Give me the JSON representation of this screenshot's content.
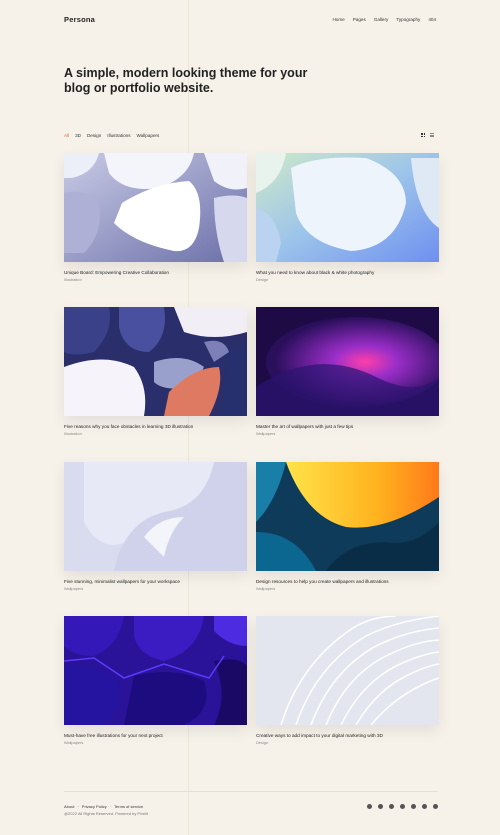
{
  "header": {
    "logo": "Persona",
    "nav": [
      "Home",
      "Pages",
      "Gallery",
      "Typography",
      "404"
    ]
  },
  "hero": {
    "title": "A simple, modern looking theme for your blog or portfolio website."
  },
  "filters": {
    "items": [
      "All",
      "3D",
      "Design",
      "Illustrations",
      "Wallpapers"
    ],
    "active": "All"
  },
  "posts": [
    {
      "title": "Unique Board: Empowering Creative Collaboration",
      "category": "Illustration"
    },
    {
      "title": "What you need to know about black & white photography",
      "category": "Design"
    },
    {
      "title": "Five reasons why you face obstacles in learning 3D illustration",
      "category": "Illustration"
    },
    {
      "title": "Master the art of wallpapers with just a few tips",
      "category": "Wallpapers"
    },
    {
      "title": "Five stunning, minimalist wallpapers for your workspace",
      "category": "Wallpapers"
    },
    {
      "title": "Design resources to help you create wallpapers and illustrations",
      "category": "Wallpapers"
    },
    {
      "title": "Must-have free illustrations for your next project",
      "category": "Wallpapers"
    },
    {
      "title": "Creative ways to add impact to your digital marketing with 3D",
      "category": "Design"
    }
  ],
  "footer": {
    "links": [
      "About",
      "Privacy Policy",
      "Terms of service"
    ],
    "copyright": "@2022 All Rights Reserved. Powered by Pixelit",
    "social_icons": [
      "github-icon",
      "twitter-icon",
      "instagram-icon",
      "linkedin-icon",
      "vimeo-icon",
      "pinterest-icon",
      "youtube-icon"
    ]
  }
}
